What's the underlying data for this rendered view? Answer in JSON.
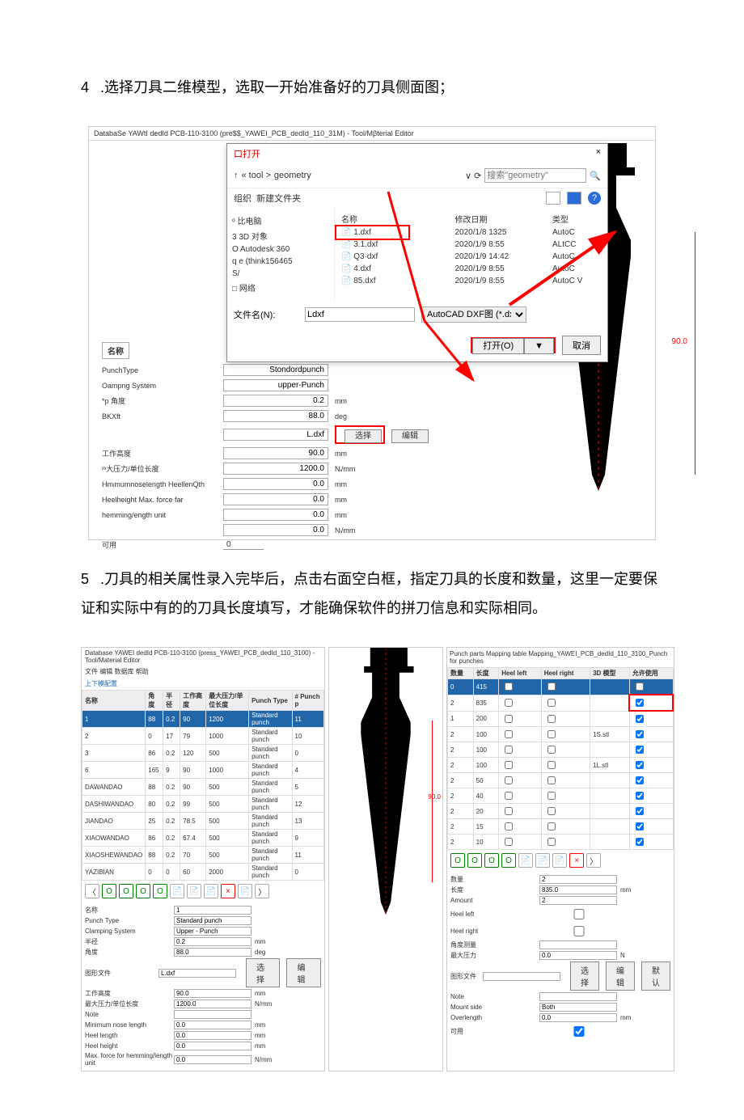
{
  "step4": {
    "num": "4",
    "text": ".选择刀具二维模型，选取一开始准备好的刀具侧面图；"
  },
  "step5": {
    "num": "5",
    "text": ".刀具的相关属性录入完毕后，点击右面空白框，指定刀具的长度和数量，这里一定要保证和实际中有的的刀具长度填写，才能确保软件的拼刀信息和实际相同。"
  },
  "fig1": {
    "title": "DatabaSe YAWtI dedId PCB-110-3100 (pre$$_YAWEI_PCB_dedId_110_31M) - Tool/Mβterial Editor",
    "dialog": {
      "title": "口打开",
      "close": "×",
      "path_prefix": "« tool >",
      "path_folder": "geometry",
      "search_ph": "搜索\"geometry\"",
      "search_icon": "🔍",
      "org": "组织",
      "newf": "新建文件夹",
      "side": [
        "ᵒ 比电脑",
        "3 3D 对象",
        "O Autodesk 360",
        "q e (think156465",
        "S/",
        "□ 网络"
      ],
      "cols": {
        "name": "名称",
        "date": "修改日期",
        "type": "类型"
      },
      "files": [
        {
          "n": "1.dxf",
          "d": "2020/1/8 1325",
          "t": "AutoC",
          "sel": true
        },
        {
          "n": "3.1.dxf",
          "d": "2020/1/9 8:55",
          "t": "ALtCC"
        },
        {
          "n": "Q3·dxf",
          "d": "2020/1/9 14:42",
          "t": "AutoC"
        },
        {
          "n": "4.dxf",
          "d": "2020/1/9 8:55",
          "t": "AutoC"
        },
        {
          "n": "85.dxf",
          "d": "2020/1/9 8:55",
          "t": "AutoC V"
        }
      ],
      "fn_label": "文件名(N):",
      "fn_value": "Ldxf",
      "filter": "AutoCAD DXF图 (*.dxf)",
      "open": "打开(O)",
      "drop": "▼",
      "cancel": "取消"
    },
    "form": {
      "name_label": "名称",
      "rows": [
        {
          "l": "PunchType",
          "v": "Stondordpunch",
          "u": ""
        },
        {
          "l": "Oampng System",
          "v": "upper-Punch",
          "u": ""
        },
        {
          "l": "*p 角度",
          "v": "0.2",
          "u": "mm"
        },
        {
          "l": "BKXft",
          "v": "88.0",
          "u": "deg"
        },
        {
          "l": "",
          "v": "L.dxf",
          "u": "",
          "btns": [
            "选择",
            "编辑"
          ],
          "red": true
        },
        {
          "l": "工作高度",
          "v": "90.0",
          "u": "mm"
        },
        {
          "l": "ᵐ大压力/单位长度",
          "v": "1200.0",
          "u": "Nᵢ/mm"
        },
        {
          "l": "Hmᵢmumnoselength HeellenQth",
          "v": "0.0",
          "u": "mm"
        },
        {
          "l": "Heelheight Max. force far",
          "v": "0.0",
          "u": "mm"
        },
        {
          "l": "hemming/ength unit",
          "v": "0.0",
          "u": "mm"
        },
        {
          "l": "",
          "v": "0.0",
          "u": "Nᵢ/mm"
        }
      ],
      "avail": "可用",
      "avail_v": "0"
    },
    "dim": "90.0"
  },
  "fig2": {
    "title": "Database YAWEI dedId PCB-110-3100 (press_YAWEI_PCB_dedId_110_3100) - Tool/Material Editor",
    "menubar": "文件  编辑  数据库  帮助",
    "tab": "上下模配置",
    "table": {
      "headers": [
        "名称",
        "角度",
        "半径",
        "工作高度",
        "最大压力/单位长度",
        "Punch Type",
        "# Punch p"
      ],
      "rows": [
        {
          "c": [
            "1",
            "88",
            "0.2",
            "90",
            "1200",
            "Standard punch",
            "11"
          ],
          "hl": true
        },
        {
          "c": [
            "2",
            "0",
            "17",
            "79",
            "1000",
            "Standard punch",
            "10"
          ]
        },
        {
          "c": [
            "3",
            "86",
            "0.2",
            "120",
            "500",
            "Standard punch",
            "0"
          ]
        },
        {
          "c": [
            "6",
            "165",
            "9",
            "90",
            "1000",
            "Standard punch",
            "4"
          ]
        },
        {
          "c": [
            "DAWANDAO",
            "88",
            "0.2",
            "90",
            "500",
            "Standard punch",
            "5"
          ]
        },
        {
          "c": [
            "DASHIWANDAO",
            "80",
            "0.2",
            "99",
            "500",
            "Standard punch",
            "12"
          ]
        },
        {
          "c": [
            "JIANDAO",
            "25",
            "0.2",
            "78.5",
            "500",
            "Standard punch",
            "13"
          ]
        },
        {
          "c": [
            "XIAOWANDAO",
            "86",
            "0.2",
            "67.4",
            "500",
            "Standard punch",
            "9"
          ]
        },
        {
          "c": [
            "XIAOSHEWANDAO",
            "88",
            "0.2",
            "70",
            "500",
            "Standard punch",
            "11"
          ]
        },
        {
          "c": [
            "YAZIBIAN",
            "0",
            "0",
            "60",
            "2000",
            "Standard punch",
            "0"
          ]
        }
      ]
    },
    "icons": [
      "〈",
      "O",
      "O",
      "O",
      "O",
      "📄",
      "📄",
      "📄",
      "×",
      "📄",
      "〉"
    ],
    "form": {
      "nameL": "名称",
      "nameV": "1",
      "rows": [
        {
          "l": "Punch Type",
          "v": "Standard punch"
        },
        {
          "l": "Clamping System",
          "v": "Upper - Punch"
        },
        {
          "l": "半径",
          "v": "0.2",
          "u": "mm"
        },
        {
          "l": "角度",
          "v": "88.0",
          "u": "deg"
        },
        {
          "l": "图形文件",
          "v": "L.dxf",
          "btns": [
            "选择",
            "编辑"
          ]
        },
        {
          "l": "工作高度",
          "v": "90.0",
          "u": "mm"
        },
        {
          "l": "最大压力/单位长度",
          "v": "1200.0",
          "u": "N/mm"
        },
        {
          "l": "Note",
          "v": ""
        },
        {
          "l": "Minimum nose length",
          "v": "0.0",
          "u": "mm"
        },
        {
          "l": "Heel length",
          "v": "0.0",
          "u": "mm"
        },
        {
          "l": "Heel height",
          "v": "0.0",
          "u": "mm"
        },
        {
          "l": "Max. force for hemming/length unit",
          "v": "0.0",
          "u": "N/mm"
        }
      ]
    },
    "dim": "90.0",
    "right": {
      "title": "Punch parts   Mapping table Mapping_YAWEI_PCB_dedId_110_3100_Punch for punches",
      "headers": [
        "数量",
        "长度",
        "Heel left",
        "Heel right",
        "3D 模型",
        "允许使用"
      ],
      "rows": [
        {
          "c": [
            "0",
            "415",
            "",
            "",
            "",
            ""
          ],
          "hl": true
        },
        {
          "c": [
            "2",
            "835",
            "",
            "",
            "",
            "✓"
          ],
          "red": true
        },
        {
          "c": [
            "1",
            "200",
            "",
            "",
            "",
            "✓"
          ]
        },
        {
          "c": [
            "2",
            "100",
            "",
            "",
            "1S.stl",
            "✓"
          ]
        },
        {
          "c": [
            "2",
            "100",
            "",
            "",
            "",
            "✓"
          ]
        },
        {
          "c": [
            "2",
            "100",
            "",
            "",
            "1L.stl",
            "✓"
          ]
        },
        {
          "c": [
            "2",
            "50",
            "",
            "",
            "",
            "✓"
          ]
        },
        {
          "c": [
            "2",
            "40",
            "",
            "",
            "",
            "✓"
          ]
        },
        {
          "c": [
            "2",
            "20",
            "",
            "",
            "",
            "✓"
          ]
        },
        {
          "c": [
            "2",
            "15",
            "",
            "",
            "",
            "✓"
          ]
        },
        {
          "c": [
            "2",
            "10",
            "",
            "",
            "",
            "✓"
          ]
        }
      ],
      "icons": [
        "O",
        "O",
        "O",
        "O",
        "📄",
        "📄",
        "📄",
        "×",
        "〉"
      ],
      "form": [
        {
          "l": "数量",
          "v": "2"
        },
        {
          "l": "长度",
          "v": "835.0",
          "u": "mm"
        },
        {
          "l": "Amount",
          "v": "2"
        },
        {
          "l": "Heel left",
          "cb": false
        },
        {
          "l": "Heel right",
          "cb": false
        },
        {
          "l": "角度测量",
          "v": ""
        },
        {
          "l": "最大压力",
          "v": "0.0",
          "u": "N"
        },
        {
          "l": "图形文件",
          "v": "",
          "btns": [
            "选择",
            "编辑",
            "默认"
          ]
        },
        {
          "l": "Note",
          "v": ""
        },
        {
          "l": "Mount side",
          "v": "Both"
        },
        {
          "l": "Overlength",
          "v": "0.0",
          "u": "mm"
        },
        {
          "l": "可用",
          "cb": true
        }
      ]
    }
  }
}
